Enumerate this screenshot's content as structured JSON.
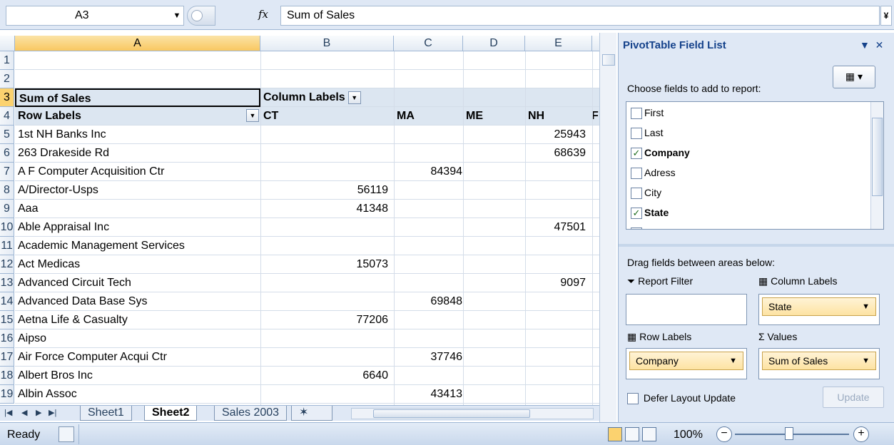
{
  "formula_bar": {
    "name_box": "A3",
    "formula": "Sum of Sales",
    "fx_label": "fx",
    "expand_glyph": "¥"
  },
  "columns": [
    "A",
    "B",
    "C",
    "D",
    "E"
  ],
  "row_numbers": [
    "1",
    "2",
    "3",
    "4",
    "5",
    "6",
    "7",
    "8",
    "9",
    "10",
    "11",
    "12",
    "13",
    "14",
    "15",
    "16",
    "17",
    "18",
    "19"
  ],
  "pivot_header": {
    "sum_label": "Sum of Sales",
    "column_labels": "Column Labels",
    "row_labels": "Row Labels",
    "states": [
      "CT",
      "MA",
      "ME",
      "NH",
      "F"
    ]
  },
  "rows": [
    {
      "name": "1st NH Banks Inc",
      "ct": "",
      "ma": "",
      "nh": "25943"
    },
    {
      "name": "263 Drakeside Rd",
      "ct": "",
      "ma": "",
      "nh": "68639"
    },
    {
      "name": "A F Computer Acquisition Ctr",
      "ct": "",
      "ma": "84394",
      "nh": ""
    },
    {
      "name": "A/Director-Usps",
      "ct": "56119",
      "ma": "",
      "nh": ""
    },
    {
      "name": "Aaa",
      "ct": "41348",
      "ma": "",
      "nh": ""
    },
    {
      "name": "Able Appraisal Inc",
      "ct": "",
      "ma": "",
      "nh": "47501"
    },
    {
      "name": "Academic Management Services",
      "ct": "",
      "ma": "",
      "nh": ""
    },
    {
      "name": "Act Medicas",
      "ct": "15073",
      "ma": "",
      "nh": ""
    },
    {
      "name": "Advanced Circuit Tech",
      "ct": "",
      "ma": "",
      "nh": "9097"
    },
    {
      "name": "Advanced Data Base Sys",
      "ct": "",
      "ma": "69848",
      "nh": ""
    },
    {
      "name": "Aetna Life & Casualty",
      "ct": "77206",
      "ma": "",
      "nh": ""
    },
    {
      "name": "Aipso",
      "ct": "",
      "ma": "",
      "nh": ""
    },
    {
      "name": "Air Force Computer Acqui Ctr",
      "ct": "",
      "ma": "37746",
      "nh": ""
    },
    {
      "name": "Albert Bros Inc",
      "ct": "6640",
      "ma": "",
      "nh": ""
    },
    {
      "name": "Albin Assoc",
      "ct": "",
      "ma": "43413",
      "nh": ""
    }
  ],
  "sheet_tabs": [
    "Sheet1",
    "Sheet2",
    "Sales 2003"
  ],
  "active_tab": "Sheet2",
  "status": {
    "ready": "Ready",
    "zoom": "100%"
  },
  "pivot_panel": {
    "title": "PivotTable Field List",
    "choose_label": "Choose fields to add to report:",
    "fields": [
      {
        "label": "First",
        "checked": false
      },
      {
        "label": "Last",
        "checked": false
      },
      {
        "label": "Company",
        "checked": true
      },
      {
        "label": "Adress",
        "checked": false
      },
      {
        "label": "City",
        "checked": false
      },
      {
        "label": "State",
        "checked": true
      },
      {
        "label": "Zip",
        "checked": false
      }
    ],
    "drag_label": "Drag fields between areas below:",
    "report_filter": "Report Filter",
    "column_labels": "Column Labels",
    "row_labels": "Row Labels",
    "values": "Values",
    "column_item": "State",
    "row_item": "Company",
    "values_item": "Sum of Sales",
    "defer_label": "Defer Layout Update",
    "update_label": "Update"
  }
}
